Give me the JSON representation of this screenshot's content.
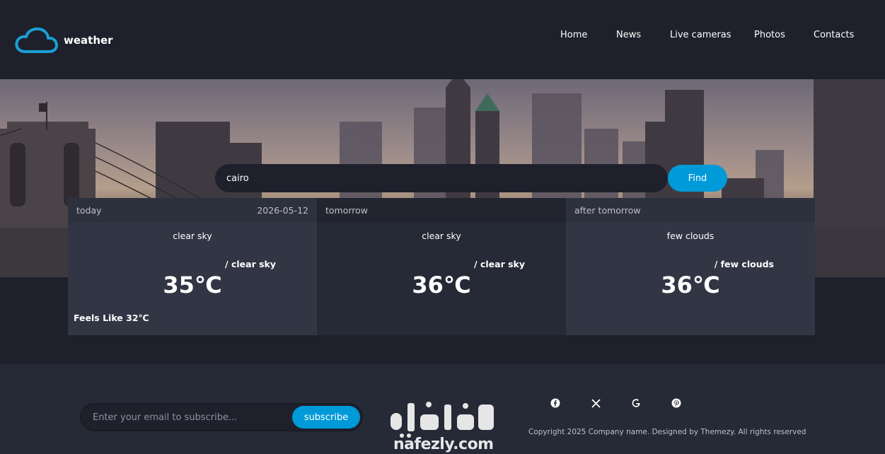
{
  "header": {
    "logo_text": "weather",
    "nav": [
      "Home",
      "News",
      "Live cameras",
      "Photos",
      "Contacts"
    ]
  },
  "search": {
    "value": "cairo",
    "button_label": "Find"
  },
  "forecast": [
    {
      "day": "today",
      "date": "2026-05-12",
      "condition": "clear sky",
      "description": "/ clear sky",
      "temp": "35℃",
      "feels_like": "Feels Like 32℃"
    },
    {
      "day": "tomorrow",
      "condition": "clear sky",
      "description": "/ clear sky",
      "temp": "36℃"
    },
    {
      "day": "after tomorrow",
      "condition": "few clouds",
      "description": "/ few clouds",
      "temp": "36℃"
    }
  ],
  "footer": {
    "email_placeholder": "Enter your email to subscribe...",
    "subscribe_label": "subscribe",
    "watermark_text": "nafezly.com",
    "social_icons": [
      "facebook-icon",
      "x-icon",
      "google-icon",
      "pinterest-icon"
    ],
    "copyright": "Copyright 2025 Company name. Designed by Themezy. All rights reserved"
  },
  "colors": {
    "accent": "#009ad8",
    "background": "#1e202b",
    "card": "#323544"
  }
}
